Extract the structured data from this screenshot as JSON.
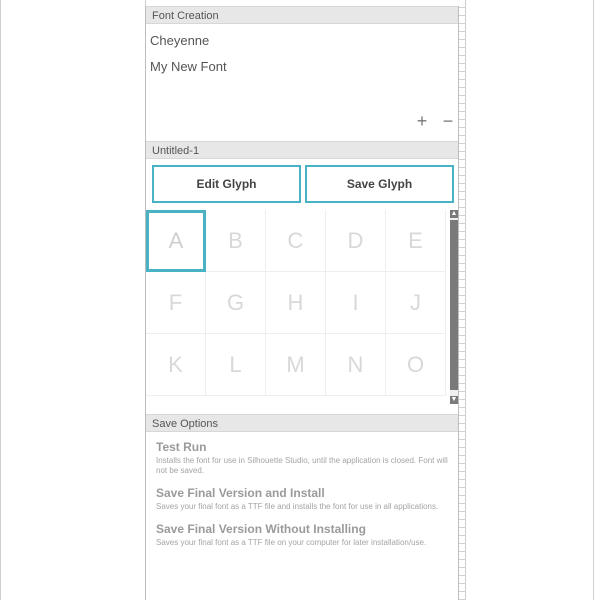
{
  "font_creation": {
    "header": "Font Creation",
    "fonts": [
      "Cheyenne",
      "My New Font"
    ],
    "add_label": "+",
    "remove_label": "−"
  },
  "glyph_editor": {
    "header": "Untitled-1",
    "edit_label": "Edit Glyph",
    "save_label": "Save Glyph",
    "glyphs": [
      "A",
      "B",
      "C",
      "D",
      "E",
      "F",
      "G",
      "H",
      "I",
      "J",
      "K",
      "L",
      "M",
      "N",
      "O"
    ],
    "selected_glyph": "A",
    "accent_color": "#49b3c5"
  },
  "save_options": {
    "header": "Save Options",
    "items": [
      {
        "title": "Test Run",
        "desc": "Installs the font for use in Silhouette Studio, until the application is closed. Font will not be saved."
      },
      {
        "title": "Save Final Version and Install",
        "desc": "Saves your final font as a TTF file and installs the font for use in all applications."
      },
      {
        "title": "Save Final Version Without Installing",
        "desc": "Saves your final font as a TTF file on your computer for later installation/use."
      }
    ]
  }
}
